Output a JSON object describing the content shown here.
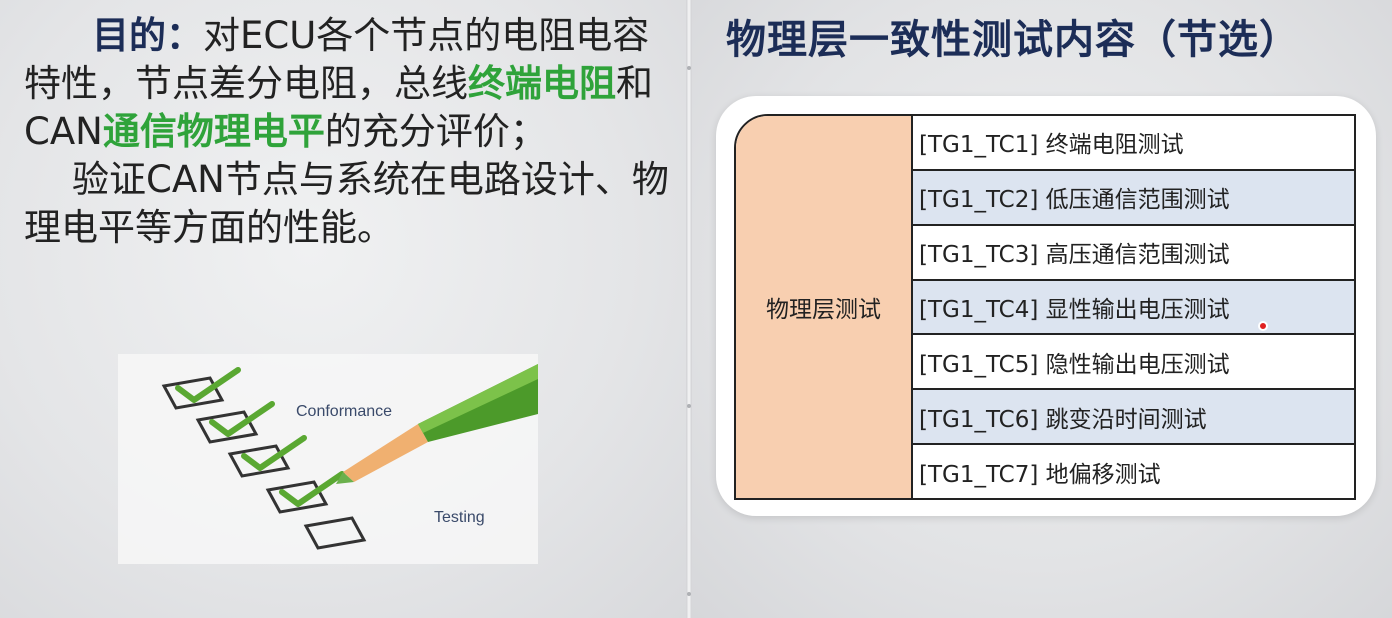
{
  "left": {
    "purpose_label": "目的：",
    "text_1": "对ECU各个节点的电阻电容特性，节点差分电阻，总线",
    "green_1": "终端电阻",
    "text_2": "和CAN",
    "green_2": "通信物理电平",
    "text_3": "的充分评价；",
    "text_4": "验证CAN节点与系统在电路设计、物理电平等方面的性能。",
    "illustration": {
      "word_1": "Conformance",
      "word_2": "Testing",
      "icon": "checklist-pencil-illustration"
    }
  },
  "right": {
    "title": "物理层一致性测试内容（节选）",
    "table": {
      "category": "物理层测试",
      "items": [
        "[TG1_TC1] 终端电阻测试",
        "[TG1_TC2] 低压通信范围测试",
        "[TG1_TC3] 高压通信范围测试",
        "[TG1_TC4] 显性输出电压测试",
        "[TG1_TC5] 隐性输出电压测试",
        "[TG1_TC6] 跳变沿时间测试",
        "[TG1_TC7] 地偏移测试"
      ]
    }
  },
  "colors": {
    "title_navy": "#1c2d57",
    "highlight_green": "#2fa33a",
    "category_fill": "#f8cfb0",
    "alt_row_fill": "#dce4f0"
  }
}
